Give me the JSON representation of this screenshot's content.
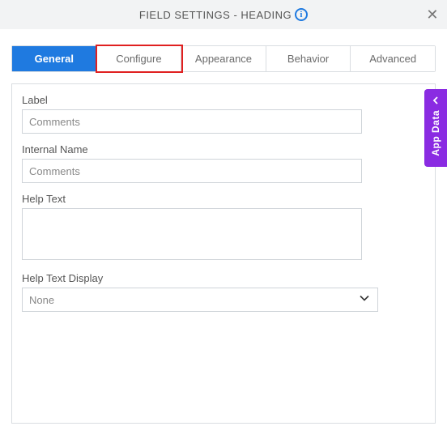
{
  "header": {
    "title": "FIELD SETTINGS - HEADING"
  },
  "tabs": {
    "general": "General",
    "configure": "Configure",
    "appearance": "Appearance",
    "behavior": "Behavior",
    "advanced": "Advanced"
  },
  "fields": {
    "label": {
      "label": "Label",
      "value": "Comments"
    },
    "internalName": {
      "label": "Internal Name",
      "value": "Comments"
    },
    "helpText": {
      "label": "Help Text",
      "value": ""
    },
    "helpTextDisplay": {
      "label": "Help Text Display",
      "value": "None"
    }
  },
  "sidePanel": {
    "label": "App Data"
  }
}
